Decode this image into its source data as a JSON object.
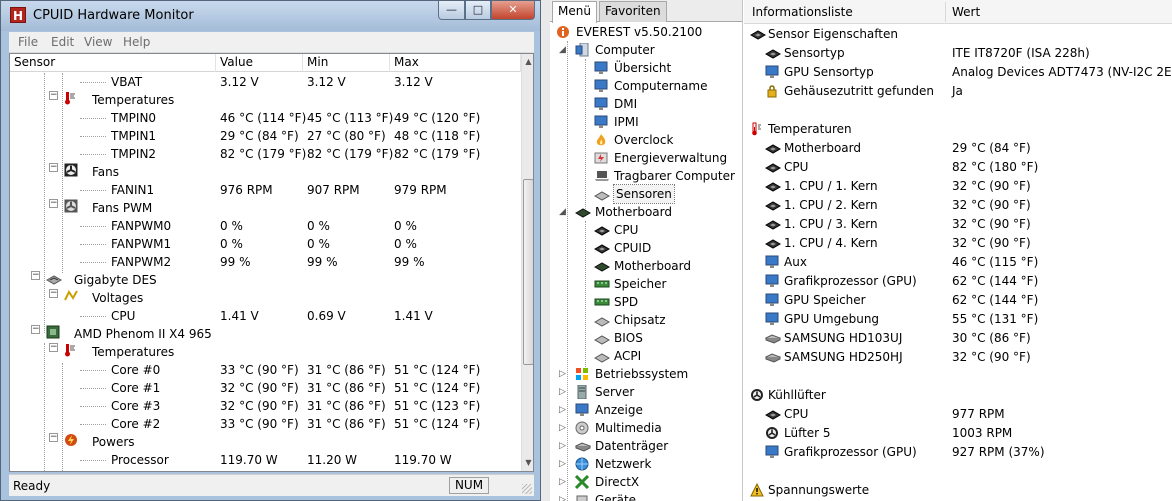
{
  "hwm": {
    "icon_letter": "H",
    "title": "CPUID Hardware Monitor",
    "window_buttons": {
      "minimize": "—",
      "maximize": "□",
      "close": "✕"
    },
    "menu": [
      "File",
      "Edit",
      "View",
      "Help"
    ],
    "columns": [
      "Sensor",
      "Value",
      "Min",
      "Max"
    ],
    "rows": [
      {
        "label": "VBAT",
        "value": "3.12 V",
        "min": "3.12 V",
        "max": "3.12 V"
      },
      {
        "label": "Temperatures"
      },
      {
        "label": "TMPIN0",
        "value": "46 °C  (114 °F)",
        "min": "45 °C  (113 °F)",
        "max": "49 °C  (120 °F)"
      },
      {
        "label": "TMPIN1",
        "value": "29 °C  (84 °F)",
        "min": "27 °C  (80 °F)",
        "max": "48 °C  (118 °F)"
      },
      {
        "label": "TMPIN2",
        "value": "82 °C  (179 °F)",
        "min": "82 °C  (179 °F)",
        "max": "82 °C  (179 °F)"
      },
      {
        "label": "Fans"
      },
      {
        "label": "FANIN1",
        "value": "976 RPM",
        "min": "907 RPM",
        "max": "979 RPM"
      },
      {
        "label": "Fans PWM"
      },
      {
        "label": "FANPWM0",
        "value": "0 %",
        "min": "0 %",
        "max": "0 %"
      },
      {
        "label": "FANPWM1",
        "value": "0 %",
        "min": "0 %",
        "max": "0 %"
      },
      {
        "label": "FANPWM2",
        "value": "99 %",
        "min": "99 %",
        "max": "99 %"
      },
      {
        "label": "Gigabyte DES"
      },
      {
        "label": "Voltages"
      },
      {
        "label": "CPU",
        "value": "1.41 V",
        "min": "0.69 V",
        "max": "1.41 V"
      },
      {
        "label": "AMD Phenom II X4 965"
      },
      {
        "label": "Temperatures"
      },
      {
        "label": "Core #0",
        "value": "33 °C  (90 °F)",
        "min": "31 °C  (86 °F)",
        "max": "51 °C  (124 °F)"
      },
      {
        "label": "Core #1",
        "value": "32 °C  (90 °F)",
        "min": "31 °C  (86 °F)",
        "max": "51 °C  (124 °F)"
      },
      {
        "label": "Core #3",
        "value": "32 °C  (90 °F)",
        "min": "31 °C  (86 °F)",
        "max": "51 °C  (123 °F)"
      },
      {
        "label": "Core #2",
        "value": "33 °C  (90 °F)",
        "min": "31 °C  (86 °F)",
        "max": "51 °C  (124 °F)"
      },
      {
        "label": "Powers"
      },
      {
        "label": "Processor",
        "value": "119.70 W",
        "min": "11.20 W",
        "max": "119.70 W"
      }
    ],
    "status": {
      "text": "Ready",
      "num": "NUM"
    }
  },
  "menu_panel": {
    "tabs": [
      "Menü",
      "Favoriten"
    ],
    "items": [
      "EVEREST v5.50.2100",
      "Computer",
      "Übersicht",
      "Computername",
      "DMI",
      "IPMI",
      "Overclock",
      "Energieverwaltung",
      "Tragbarer Computer",
      "Sensoren",
      "Motherboard",
      "CPU",
      "CPUID",
      "Motherboard",
      "Speicher",
      "SPD",
      "Chipsatz",
      "BIOS",
      "ACPI",
      "Betriebssystem",
      "Server",
      "Anzeige",
      "Multimedia",
      "Datenträger",
      "Netzwerk",
      "DirectX",
      "Geräte"
    ]
  },
  "info_panel": {
    "headers": [
      "Informationsliste",
      "Wert"
    ],
    "sections": [
      {
        "title": "Sensor Eigenschaften",
        "rows": [
          {
            "label": "Sensortyp",
            "value": "ITE IT8720F  (ISA 228h)"
          },
          {
            "label": "GPU Sensortyp",
            "value": "Analog Devices ADT7473  (NV-I2C 2Eh)"
          },
          {
            "label": "Gehäusezutritt gefunden",
            "value": "Ja"
          }
        ]
      },
      {
        "title": "Temperaturen",
        "rows": [
          {
            "label": "Motherboard",
            "value": "29 °C  (84 °F)"
          },
          {
            "label": "CPU",
            "value": "82 °C  (180 °F)"
          },
          {
            "label": "1. CPU / 1. Kern",
            "value": "32 °C  (90 °F)"
          },
          {
            "label": "1. CPU / 2. Kern",
            "value": "32 °C  (90 °F)"
          },
          {
            "label": "1. CPU / 3. Kern",
            "value": "32 °C  (90 °F)"
          },
          {
            "label": "1. CPU / 4. Kern",
            "value": "32 °C  (90 °F)"
          },
          {
            "label": "Aux",
            "value": "46 °C  (115 °F)"
          },
          {
            "label": "Grafikprozessor (GPU)",
            "value": "62 °C  (144 °F)"
          },
          {
            "label": "GPU Speicher",
            "value": "62 °C  (144 °F)"
          },
          {
            "label": "GPU Umgebung",
            "value": "55 °C  (131 °F)"
          },
          {
            "label": "SAMSUNG HD103UJ",
            "value": "30 °C  (86 °F)"
          },
          {
            "label": "SAMSUNG HD250HJ",
            "value": "32 °C  (90 °F)"
          }
        ]
      },
      {
        "title": "Kühllüfter",
        "rows": [
          {
            "label": "CPU",
            "value": "977 RPM"
          },
          {
            "label": "Lüfter 5",
            "value": "1003 RPM"
          },
          {
            "label": "Grafikprozessor (GPU)",
            "value": "927 RPM  (37%)"
          }
        ]
      },
      {
        "title": "Spannungswerte",
        "rows": []
      }
    ]
  }
}
